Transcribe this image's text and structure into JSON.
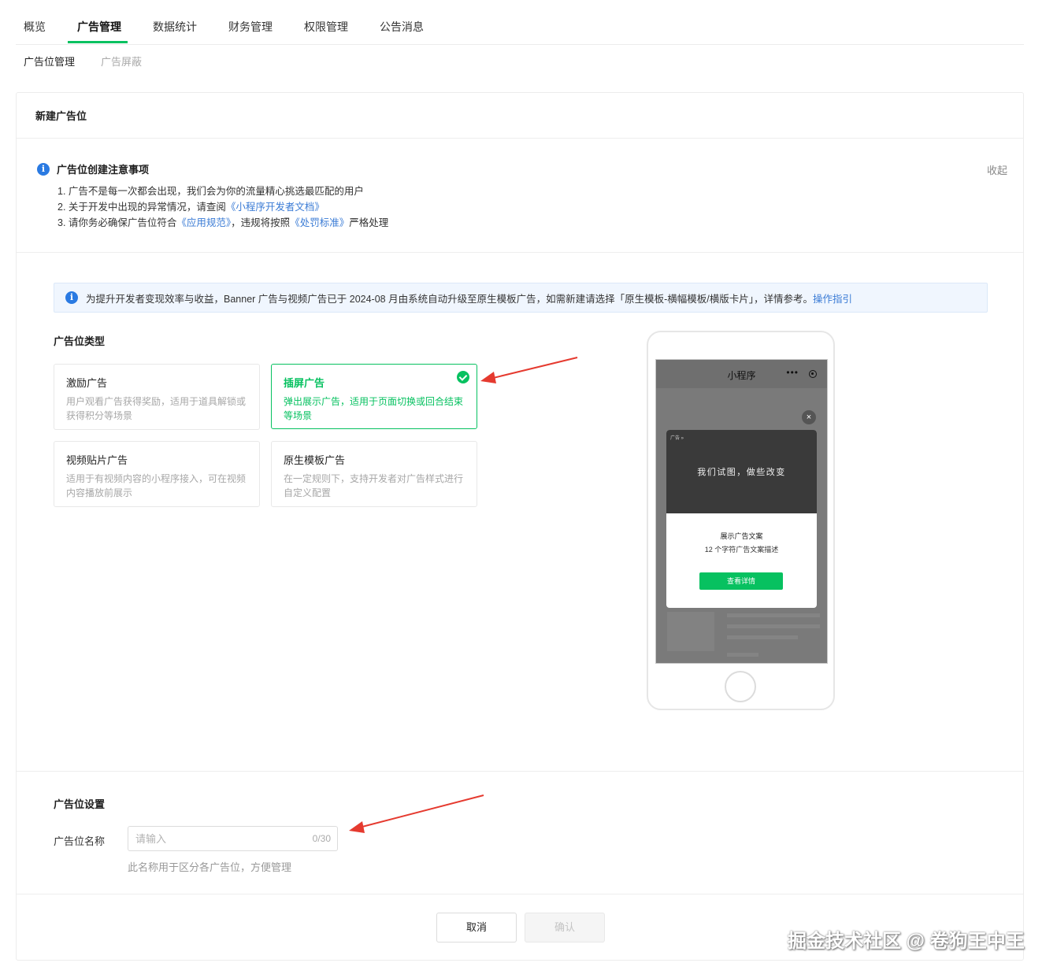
{
  "top_tabs": [
    "概览",
    "广告管理",
    "数据统计",
    "财务管理",
    "权限管理",
    "公告消息"
  ],
  "active_tab_index": 1,
  "sub_tabs": [
    "广告位管理",
    "广告屏蔽"
  ],
  "card_title": "新建广告位",
  "notice": {
    "title": "广告位创建注意事项",
    "collapse": "收起",
    "line1": "1. 广告不是每一次都会出现，我们会为你的流量精心挑选最匹配的用户",
    "line2_prefix": "2. 关于开发中出现的异常情况，请查阅",
    "line2_link": "《小程序开发者文档》",
    "line3_prefix": "3. 请你务必确保广告位符合",
    "line3_link1": "《应用规范》",
    "line3_mid": "，违规将按照",
    "line3_link2": "《处罚标准》",
    "line3_suffix": "严格处理"
  },
  "banner": {
    "text": "为提升开发者变现效率与收益，Banner 广告与视频广告已于 2024-08 月由系统自动升级至原生模板广告，如需新建请选择「原生模板-横幅模板/横版卡片」，详情参考。",
    "link": "操作指引"
  },
  "ad_type": {
    "title": "广告位类型",
    "options": [
      {
        "name": "激励广告",
        "desc": "用户观看广告获得奖励，适用于道具解锁或获得积分等场景",
        "selected": false
      },
      {
        "name": "插屏广告",
        "desc": "弹出展示广告，适用于页面切换或回合结束等场景",
        "selected": true
      },
      {
        "name": "视频贴片广告",
        "desc": "适用于有视频内容的小程序接入，可在视频内容播放前展示",
        "selected": false
      },
      {
        "name": "原生模板广告",
        "desc": "在一定规则下，支持开发者对广告样式进行自定义配置",
        "selected": false
      }
    ]
  },
  "preview": {
    "mp_title": "小程序",
    "menu_dots": "•••",
    "close": "×",
    "ad_tag": "广告 »",
    "slogan": "我们试图，做些改变",
    "copy": "展示广告文案",
    "desc": "12 个字符广告文案描述",
    "button": "查看详情"
  },
  "settings": {
    "title": "广告位设置",
    "name_label": "广告位名称",
    "name_value": "",
    "name_placeholder": "请输入",
    "counter": "0/30",
    "hint": "此名称用于区分各广告位，方便管理"
  },
  "actions": {
    "cancel": "取消",
    "confirm": "确认"
  },
  "watermark": "掘金技术社区 @ 卷狗王中王",
  "colors": {
    "accent": "#07c160",
    "link": "#3a7bd5",
    "info": "#2a7ae2",
    "arrow": "#e53a2f"
  }
}
